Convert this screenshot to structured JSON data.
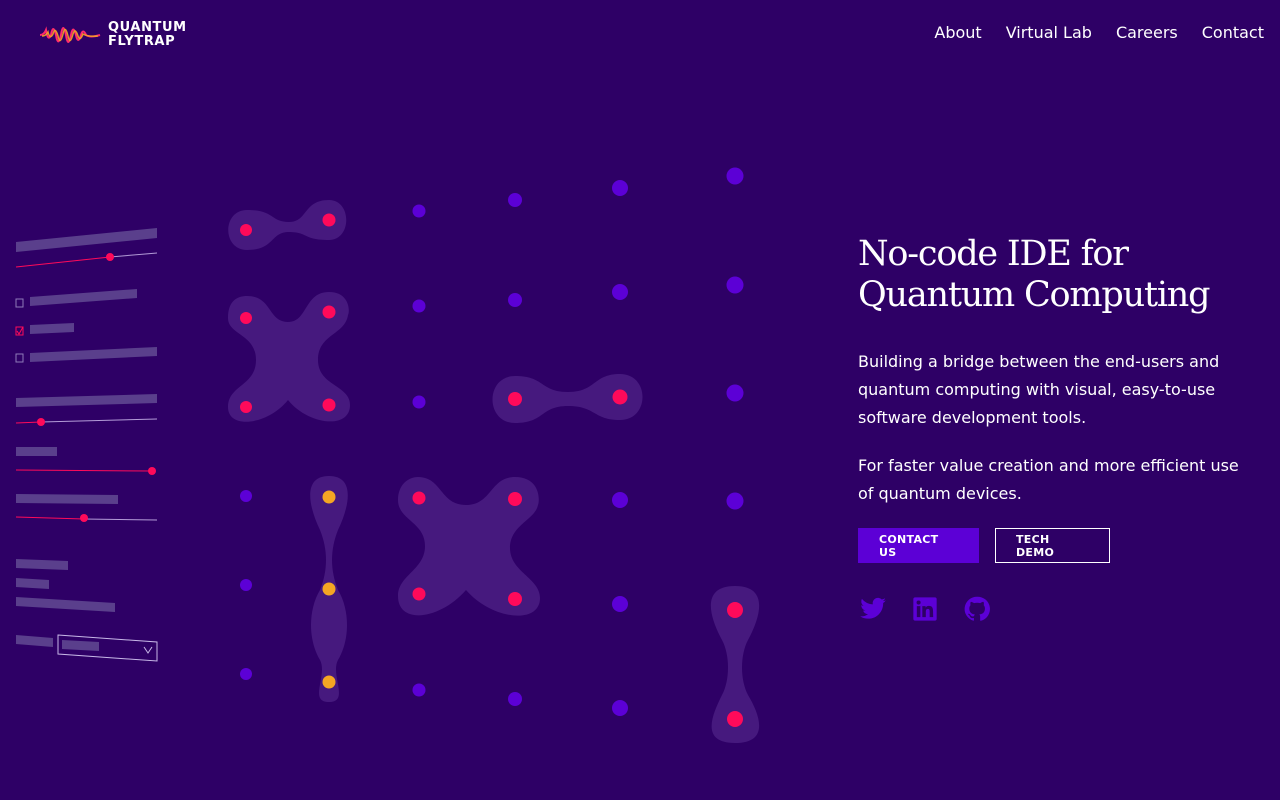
{
  "brand": {
    "name_line1": "QUANTUM",
    "name_line2": "FLYTRAP"
  },
  "nav": {
    "items": [
      "About",
      "Virtual Lab",
      "Careers",
      "Contact"
    ]
  },
  "hero": {
    "title_line1": "No-code IDE for",
    "title_line2": "Quantum Computing",
    "paragraph1": "Building a bridge between the end-users and quantum computing with visual, easy-to-use software development tools.",
    "paragraph2": "For faster value creation and more efficient use of quantum devices.",
    "primary_button": "CONTACT US",
    "secondary_button": "TECH DEMO"
  },
  "social": [
    "twitter-icon",
    "linkedin-icon",
    "github-icon"
  ],
  "colors": {
    "background": "#2e0066",
    "accent_purple": "#5c00d6",
    "qubit_pink": "#ff0a5a",
    "qubit_orange": "#f5a623",
    "blob": "#46197e"
  }
}
